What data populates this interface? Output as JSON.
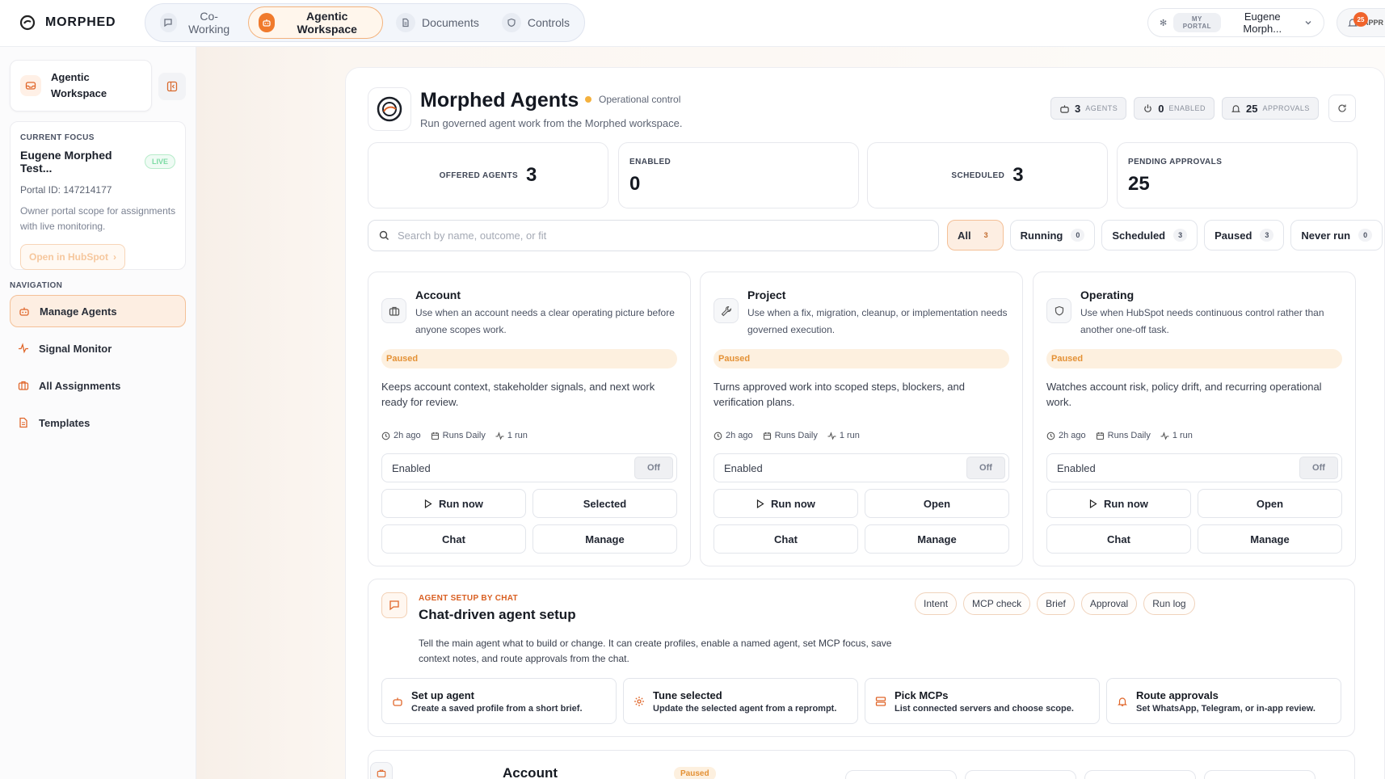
{
  "brand": {
    "name": "MORPHED"
  },
  "topnav": {
    "tabs": [
      {
        "label": "Co-Working",
        "icon": "chat-icon"
      },
      {
        "label": "Agentic Workspace",
        "icon": "robot-icon",
        "active": true
      },
      {
        "label": "Documents",
        "icon": "document-icon"
      },
      {
        "label": "Controls",
        "icon": "shield-icon"
      }
    ],
    "portal_tag": "MY PORTAL",
    "portal_name": "Eugene Morph...",
    "approvals_label": "APPR",
    "approvals_badge": "25"
  },
  "sidebar": {
    "workspace_title": "Agentic Workspace",
    "focus": {
      "caption": "CURRENT FOCUS",
      "name": "Eugene Morphed Test...",
      "status": "LIVE",
      "portal_id": "Portal ID: 147214177",
      "description": "Owner portal scope for assignments with live monitoring.",
      "hubspot_label": "Open in HubSpot"
    },
    "nav_caption": "NAVIGATION",
    "nav": [
      {
        "label": "Manage Agents",
        "icon": "robot-icon",
        "active": true
      },
      {
        "label": "Signal Monitor",
        "icon": "pulse-icon"
      },
      {
        "label": "All Assignments",
        "icon": "briefcase-icon"
      },
      {
        "label": "Templates",
        "icon": "document-icon"
      }
    ]
  },
  "header": {
    "title": "Morphed Agents",
    "status": "Operational control",
    "subtitle": "Run governed agent work from the Morphed workspace.",
    "chips": [
      {
        "value": "3",
        "label": "AGENTS"
      },
      {
        "value": "0",
        "label": "ENABLED"
      },
      {
        "value": "25",
        "label": "APPROVALS"
      }
    ]
  },
  "stats": [
    {
      "label": "OFFERED AGENTS",
      "value": "3"
    },
    {
      "label": "ENABLED",
      "value": "0"
    },
    {
      "label": "SCHEDULED",
      "value": "3"
    },
    {
      "label": "PENDING APPROVALS",
      "value": "25"
    }
  ],
  "search": {
    "placeholder": "Search by name, outcome, or fit"
  },
  "filters": [
    {
      "label": "All",
      "count": "3",
      "active": true
    },
    {
      "label": "Running",
      "count": "0"
    },
    {
      "label": "Scheduled",
      "count": "3"
    },
    {
      "label": "Paused",
      "count": "3"
    },
    {
      "label": "Never run",
      "count": "0"
    }
  ],
  "agents": [
    {
      "title": "Account",
      "icon": "briefcase-icon",
      "description": "Use when an account needs a clear operating picture before anyone scopes work.",
      "status": "Paused",
      "body": "Keeps account context, stakeholder signals, and next work ready for review.",
      "last_run": "2h ago",
      "schedule": "Runs Daily",
      "runs": "1 run",
      "toggle_label": "Enabled",
      "toggle_state": "Off",
      "run_label": "Run now",
      "secondary_label": "Selected",
      "chat_label": "Chat",
      "manage_label": "Manage"
    },
    {
      "title": "Project",
      "icon": "wrench-icon",
      "description": "Use when a fix, migration, cleanup, or implementation needs governed execution.",
      "status": "Paused",
      "body": "Turns approved work into scoped steps, blockers, and verification plans.",
      "last_run": "2h ago",
      "schedule": "Runs Daily",
      "runs": "1 run",
      "toggle_label": "Enabled",
      "toggle_state": "Off",
      "run_label": "Run now",
      "secondary_label": "Open",
      "chat_label": "Chat",
      "manage_label": "Manage"
    },
    {
      "title": "Operating",
      "icon": "shield-icon",
      "description": "Use when HubSpot needs continuous control rather than another one-off task.",
      "status": "Paused",
      "body": "Watches account risk, policy drift, and recurring operational work.",
      "last_run": "2h ago",
      "schedule": "Runs Daily",
      "runs": "1 run",
      "toggle_label": "Enabled",
      "toggle_state": "Off",
      "run_label": "Run now",
      "secondary_label": "Open",
      "chat_label": "Chat",
      "manage_label": "Manage"
    }
  ],
  "setup": {
    "caption": "AGENT SETUP BY CHAT",
    "title": "Chat-driven agent setup",
    "description": "Tell the main agent what to build or change. It can create profiles, enable a named agent, set MCP focus, save context notes, and route approvals from the chat.",
    "tags": [
      "Intent",
      "MCP check",
      "Brief",
      "Approval",
      "Run log"
    ],
    "actions": [
      {
        "title": "Set up agent",
        "desc": "Create a saved profile from a short brief.",
        "icon": "robot-icon"
      },
      {
        "title": "Tune selected",
        "desc": "Update the selected agent from a reprompt.",
        "icon": "gear-icon"
      },
      {
        "title": "Pick MCPs",
        "desc": "List connected servers and choose scope.",
        "icon": "server-icon"
      },
      {
        "title": "Route approvals",
        "desc": "Set WhatsApp, Telegram, or in-app review.",
        "icon": "bell-icon"
      }
    ]
  },
  "detail_peek": {
    "title": "Account",
    "status": "Paused"
  },
  "colors": {
    "accent": "#f07a2c",
    "paused": "#e49135",
    "live": "#7ddba4"
  }
}
